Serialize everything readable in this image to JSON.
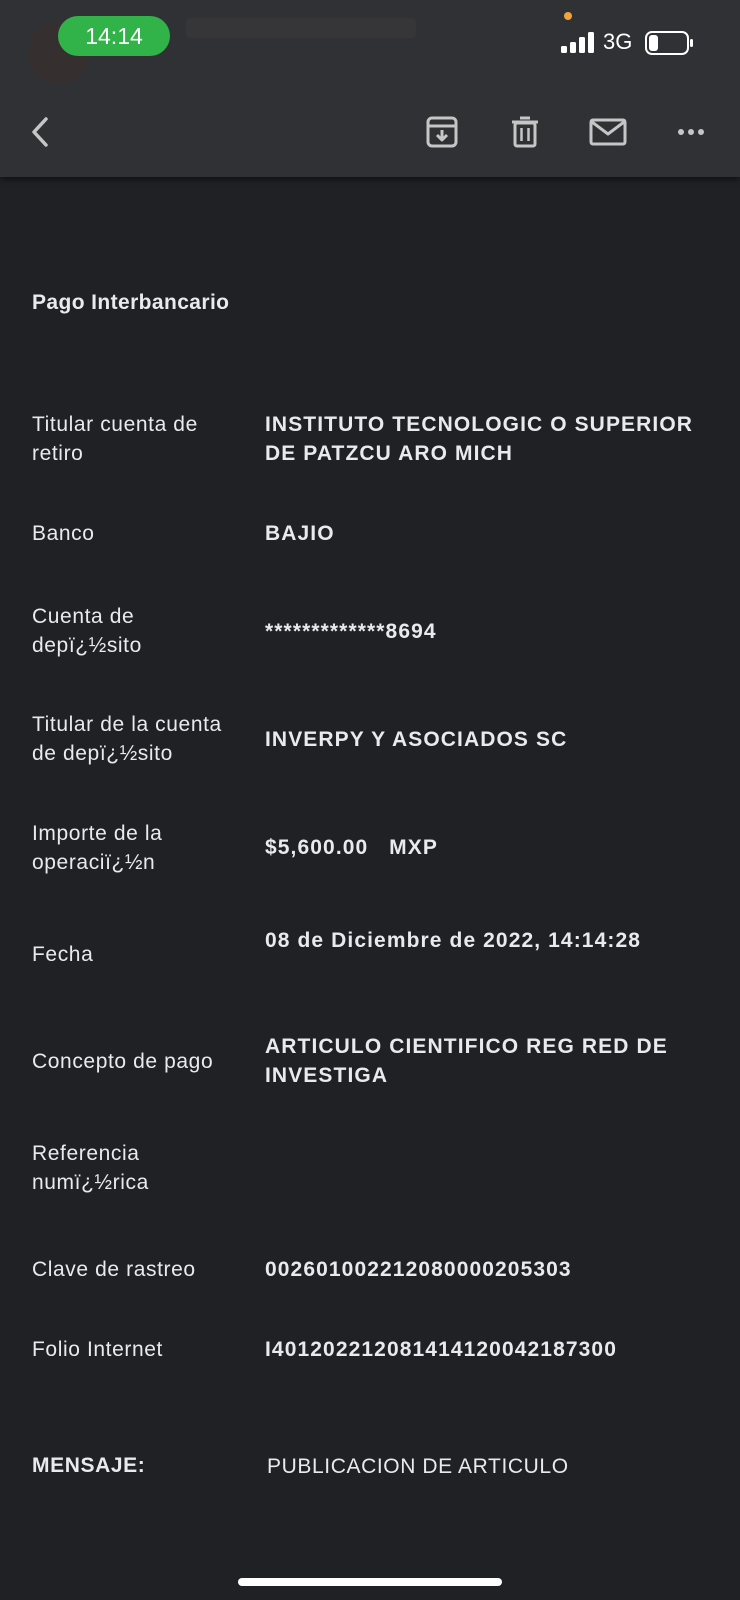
{
  "status_bar": {
    "time": "14:14",
    "network": "3G",
    "signal_bars": 4,
    "battery_level": 0.25
  },
  "toolbar": {
    "back_icon": "chevron-left-icon",
    "archive_icon": "archive-icon",
    "delete_icon": "trash-icon",
    "mark_unread_icon": "mail-icon",
    "more_icon": "more-horizontal-icon"
  },
  "email": {
    "heading": "Pago Interbancario",
    "fields": [
      {
        "label": "Titular cuenta de retiro",
        "value": "INSTITUTO TECNOLOGIC O SUPERIOR DE PATZCU ARO MICH"
      },
      {
        "label": "Banco",
        "value": "BAJIO"
      },
      {
        "label": "Cuenta de depï¿½sito",
        "value": "*************8694"
      },
      {
        "label": "Titular de la cuenta de depï¿½sito",
        "value": "INVERPY Y ASOCIADOS SC"
      },
      {
        "label": "Importe de la operaciï¿½n",
        "value": "$5,600.00   MXP"
      },
      {
        "label": "Fecha",
        "value": "08 de Diciembre de 2022, 14:14:28"
      },
      {
        "label": "Concepto de pago",
        "value": "ARTICULO CIENTIFICO REG RED DE INVESTIGA"
      },
      {
        "label": "Referencia numï¿½rica",
        "value": ""
      },
      {
        "label": "Clave de rastreo",
        "value": "002601002212080000205303"
      },
      {
        "label": "Folio Internet",
        "value": "I401202212081414120042187300"
      }
    ],
    "message_label": "MENSAJE:",
    "message_value": "PUBLICACION DE ARTICULO"
  },
  "colors": {
    "background": "#202124",
    "toolbar": "#303134",
    "text": "#e8eaed",
    "time_pill": "#32b349",
    "privacy_dot": "#f2a33a"
  }
}
